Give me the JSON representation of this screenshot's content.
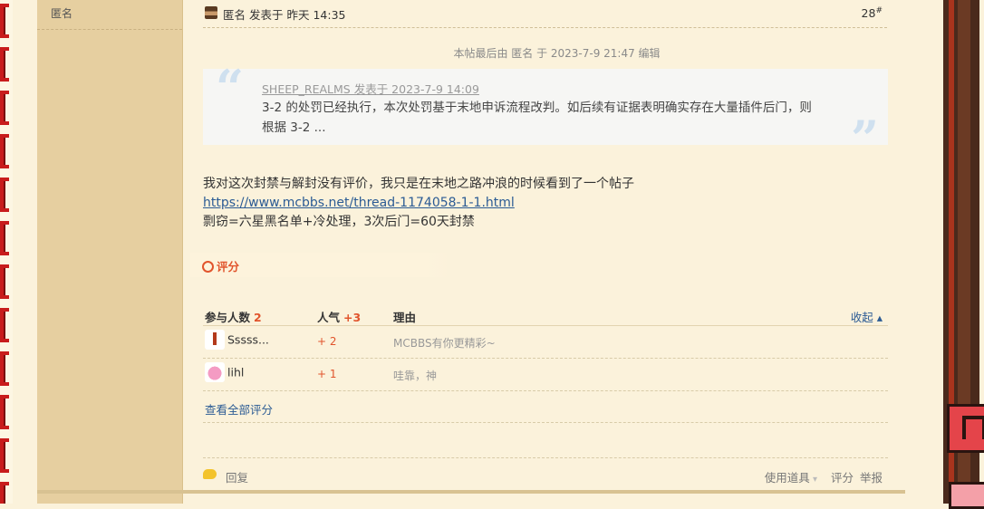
{
  "author": {
    "name": "匿名"
  },
  "post": {
    "author_name": "匿名",
    "posted_label": "发表于 昨天 14:35",
    "floor": "28",
    "floor_mark": "#",
    "edit_note": "本帖最后由 匿名 于 2023-7-9 21:47 编辑",
    "quote": {
      "header": "SHEEP_REALMS 发表于 2023-7-9 14:09",
      "body": "3-2 的处罚已经执行，本次处罚基于末地申诉流程改判。如后续有证据表明确实存在大量插件后门，则根据 3-2 ..."
    },
    "body": {
      "line1": "我对这次封禁与解封没有评价，我只是在末地之路冲浪的时候看到了一个帖子",
      "link": "https://www.mcbbs.net/thread-1174058-1-1.html",
      "line3": "剽窃=六星黑名单+冷处理，3次后门=60天封禁"
    }
  },
  "rating": {
    "tab_label": "评分",
    "header": {
      "participants_label": "参与人数",
      "participants_count": "2",
      "popularity_label": "人气",
      "popularity_value": "+3",
      "reason_label": "理由",
      "collapse_label": "收起 ▴"
    },
    "rows": [
      {
        "user": "Sssss...",
        "score": "+ 2",
        "reason": "MCBBS有你更精彩~"
      },
      {
        "user": "lihl",
        "score": "+ 1",
        "reason": "哇靠，神"
      }
    ],
    "view_all": "查看全部评分"
  },
  "footer": {
    "reply": "回复",
    "tools": "使用道具",
    "rate": "评分",
    "report": "举报"
  },
  "colors": {
    "accent": "#e1542c",
    "link": "#2b5b94",
    "author_bg": "#e6cfa0"
  }
}
